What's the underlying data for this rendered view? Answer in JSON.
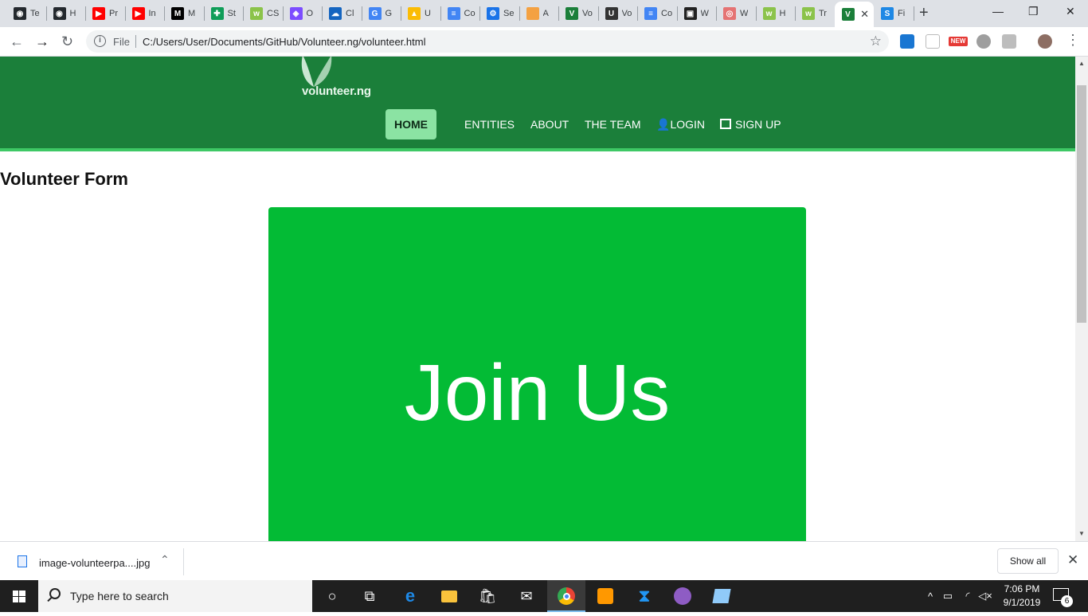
{
  "browser": {
    "tabs": [
      {
        "title": "Te",
        "color": "#24292e",
        "glyph": "◉"
      },
      {
        "title": "H",
        "color": "#24292e",
        "glyph": "◉"
      },
      {
        "title": "Pr",
        "color": "#ff0000",
        "glyph": "▶"
      },
      {
        "title": "In",
        "color": "#ff0000",
        "glyph": "▶"
      },
      {
        "title": "M",
        "color": "#000000",
        "glyph": "M"
      },
      {
        "title": "St",
        "color": "#0f9d58",
        "glyph": "✚"
      },
      {
        "title": "CS",
        "color": "#8bc34a",
        "glyph": "w"
      },
      {
        "title": "O",
        "color": "#7c4dff",
        "glyph": "◈"
      },
      {
        "title": "Cl",
        "color": "#1565c0",
        "glyph": "☁"
      },
      {
        "title": "G",
        "color": "#4285f4",
        "glyph": "G"
      },
      {
        "title": "U",
        "color": "#fbbc04",
        "glyph": "▲"
      },
      {
        "title": "Co",
        "color": "#4285f4",
        "glyph": "≡"
      },
      {
        "title": "Se",
        "color": "#1a73e8",
        "glyph": "⚙"
      },
      {
        "title": "A",
        "color": "#f4a142",
        "glyph": " "
      },
      {
        "title": "Vo",
        "color": "#1b7f3a",
        "glyph": "V"
      },
      {
        "title": "Vo",
        "color": "#333333",
        "glyph": "U"
      },
      {
        "title": "Co",
        "color": "#4285f4",
        "glyph": "≡"
      },
      {
        "title": "W",
        "color": "#222222",
        "glyph": "▣"
      },
      {
        "title": "W",
        "color": "#e57373",
        "glyph": "◎"
      },
      {
        "title": "H",
        "color": "#8bc34a",
        "glyph": "w"
      },
      {
        "title": "Tr",
        "color": "#8bc34a",
        "glyph": "w"
      },
      {
        "title": "",
        "color": "#1b7f3a",
        "glyph": "V",
        "active": true
      },
      {
        "title": "Fi",
        "color": "#1e88e5",
        "glyph": "S"
      }
    ],
    "file_label": "File",
    "url": "C:/Users/User/Documents/GitHub/Volunteer.ng/volunteer.html",
    "ext_badge": "NEW"
  },
  "site": {
    "logo_text": "volunteer.ng",
    "nav": {
      "home": "HOME",
      "entities": "ENTITIES",
      "about": "ABOUT",
      "team": "THE TEAM",
      "login": "LOGIN",
      "signup": "SIGN UP"
    },
    "form_title": "Volunteer Form",
    "card_text": "Join Us",
    "colors": {
      "header": "#1b7f3a",
      "card": "#03bb35",
      "home_pill": "#8be3a3"
    }
  },
  "downloads": {
    "filename": "image-volunteerpa....jpg",
    "show_all": "Show all"
  },
  "taskbar": {
    "search_placeholder": "Type here to search",
    "time": "7:06 PM",
    "date": "9/1/2019",
    "notifications": "6"
  }
}
